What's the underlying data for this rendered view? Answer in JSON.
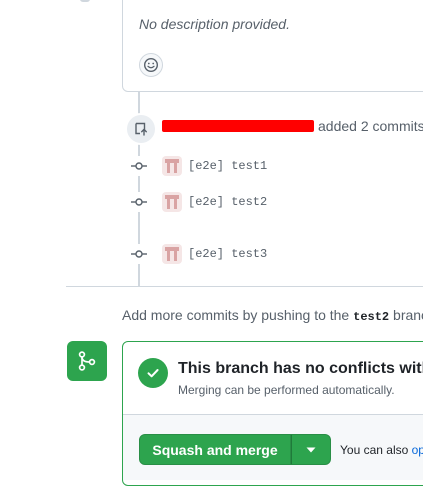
{
  "comment": {
    "description": "No description provided.",
    "reaction_icon": "smiley-icon"
  },
  "commits_event": {
    "icon": "repo-push-icon",
    "action_text": "added 2 commits",
    "commits": [
      {
        "message": "[e2e] test1"
      },
      {
        "message": "[e2e] test2"
      },
      {
        "message": "[e2e] test3"
      }
    ]
  },
  "push_hint": {
    "prefix": "Add more commits by pushing to the",
    "branch": "test2",
    "suffix": "branc"
  },
  "merge": {
    "icon": "git-merge-icon",
    "title": "This branch has no conflicts with t",
    "subtitle": "Merging can be performed automatically.",
    "button_label": "Squash and merge",
    "also_prefix": "You can also",
    "also_link": "op"
  },
  "colors": {
    "success": "#2da44e",
    "border": "#d0d7de",
    "muted": "#57606a",
    "link": "#0969da",
    "redaction": "#ff0000"
  }
}
